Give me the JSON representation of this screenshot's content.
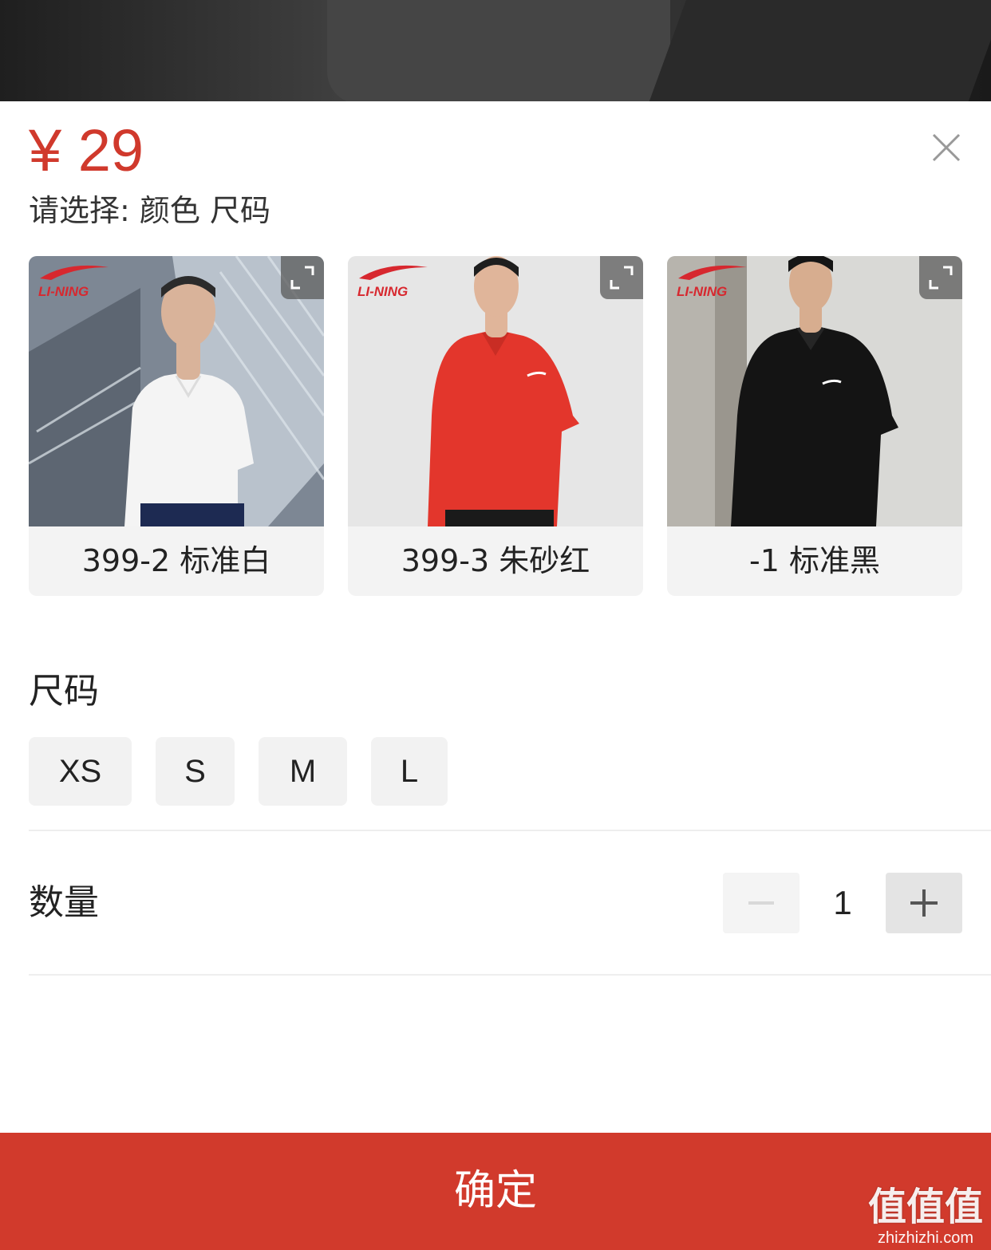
{
  "product": {
    "price": "¥ 29",
    "select_prompt": "请选择: 颜色 尺码"
  },
  "colors": {
    "options": [
      {
        "label": "399-2 标准白",
        "shirt_color": "#f2f2f2",
        "brand": "LI-NING"
      },
      {
        "label": "399-3 朱砂红",
        "shirt_color": "#e0352b",
        "brand": "LI-NING"
      },
      {
        "label": "-1 标准黑",
        "shirt_color": "#141414",
        "brand": "LI-NING"
      }
    ]
  },
  "size": {
    "title": "尺码",
    "options": [
      "XS",
      "S",
      "M",
      "L"
    ]
  },
  "quantity": {
    "title": "数量",
    "value": "1"
  },
  "actions": {
    "confirm_label": "确定"
  },
  "watermark": {
    "text": "值值值",
    "domain": "zhizhizhi.com"
  },
  "theme": {
    "accent": "#d13a2c",
    "price_color": "#d0392c"
  },
  "icons": [
    "close-icon",
    "expand-icon",
    "minus-icon",
    "plus-icon"
  ]
}
